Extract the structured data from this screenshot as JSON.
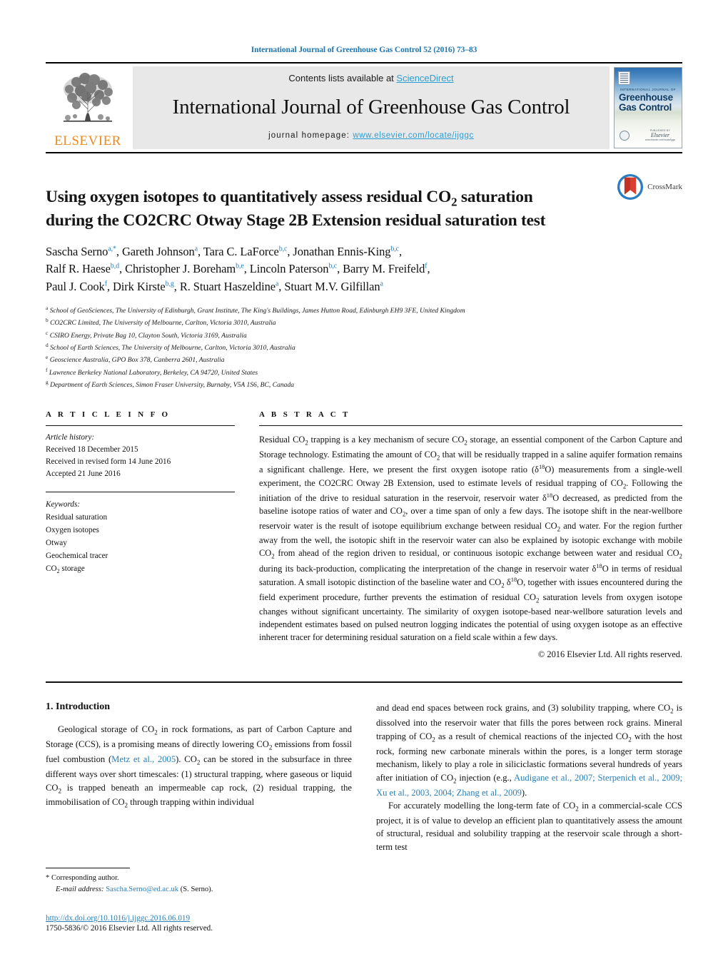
{
  "running_head": "International Journal of Greenhouse Gas Control 52 (2016) 73–83",
  "masthead": {
    "publisher_name": "ELSEVIER",
    "contents_prefix": "Contents lists available at ",
    "contents_link": "ScienceDirect",
    "journal_title": "International Journal of Greenhouse Gas Control",
    "homepage_prefix": "journal homepage: ",
    "homepage_url": "www.elsevier.com/locate/ijggc",
    "cover": {
      "kicker": "INTERNATIONAL JOURNAL OF",
      "line1": "Greenhouse",
      "line2": "Gas Control",
      "logo_top": "PUBLISHED BY",
      "logo_mid": "Elsevier",
      "logo_bottom": "www.elsevier.com/locate/ijggc"
    }
  },
  "article": {
    "title_line1": "Using oxygen isotopes to quantitatively assess residual CO",
    "title_sub1": "2",
    "title_line1b": " saturation",
    "title_line2": "during the CO2CRC Otway Stage 2B Extension residual saturation test",
    "crossmark_label": "CrossMark",
    "authors": [
      {
        "name": "Sascha Serno",
        "marks": "a,*"
      },
      {
        "name": "Gareth Johnson",
        "marks": "a"
      },
      {
        "name": "Tara C. LaForce",
        "marks": "b,c"
      },
      {
        "name": "Jonathan Ennis-King",
        "marks": "b,c"
      },
      {
        "name": "Ralf R. Haese",
        "marks": "b,d"
      },
      {
        "name": "Christopher J. Boreham",
        "marks": "b,e"
      },
      {
        "name": "Lincoln Paterson",
        "marks": "b,c"
      },
      {
        "name": "Barry M. Freifeld",
        "marks": "f"
      },
      {
        "name": "Paul J. Cook",
        "marks": "f"
      },
      {
        "name": "Dirk Kirste",
        "marks": "b,g"
      },
      {
        "name": "R. Stuart Haszeldine",
        "marks": "a"
      },
      {
        "name": "Stuart M.V. Gilfillan",
        "marks": "a"
      }
    ],
    "affiliations": [
      {
        "mark": "a",
        "text": "School of GeoSciences, The University of Edinburgh, Grant Institute, The King's Buildings, James Hutton Road, Edinburgh EH9 3FE, United Kingdom"
      },
      {
        "mark": "b",
        "text": "CO2CRC Limited, The University of Melbourne, Carlton, Victoria 3010, Australia"
      },
      {
        "mark": "c",
        "text": "CSIRO Energy, Private Bag 10, Clayton South, Victoria 3169, Australia"
      },
      {
        "mark": "d",
        "text": "School of Earth Sciences, The University of Melbourne, Carlton, Victoria 3010, Australia"
      },
      {
        "mark": "e",
        "text": "Geoscience Australia, GPO Box 378, Canberra 2601, Australia"
      },
      {
        "mark": "f",
        "text": "Lawrence Berkeley National Laboratory, Berkeley, CA 94720, United States"
      },
      {
        "mark": "g",
        "text": "Department of Earth Sciences, Simon Fraser University, Burnaby, V5A 1S6, BC, Canada"
      }
    ]
  },
  "article_info": {
    "heading": "A R T I C L E   I N F O",
    "history_label": "Article history:",
    "history": [
      "Received 18 December 2015",
      "Received in revised form 14 June 2016",
      "Accepted 21 June 2016"
    ],
    "keywords_label": "Keywords:",
    "keywords": [
      "Residual saturation",
      "Oxygen isotopes",
      "Otway",
      "Geochemical tracer",
      "CO2 storage"
    ]
  },
  "abstract": {
    "heading": "A B S T R A C T",
    "copyright": "© 2016 Elsevier Ltd. All rights reserved."
  },
  "introduction": {
    "heading": "1. Introduction",
    "left_refs": [
      "Metz et al., 2005"
    ],
    "right_refs": [
      "Audigane et al., 2007; Sterpenich et al., 2009; Xu et al., 2003, 2004; Zhang et al., 2009"
    ]
  },
  "footer": {
    "corresponding": "* Corresponding author.",
    "email_label": "E-mail address:",
    "email": "Sascha.Serno@ed.ac.uk",
    "email_suffix": "(S. Serno).",
    "doi": "http://dx.doi.org/10.1016/j.ijggc.2016.06.019",
    "issn": "1750-5836/© 2016 Elsevier Ltd. All rights reserved."
  },
  "colors": {
    "link_blue": "#2a7fb8",
    "header_blue": "#1f76b0",
    "sciencedirect_blue": "#2a9fd6",
    "elsevier_orange": "#ec8a1e",
    "banner_gray": "#e8e8e8",
    "crossmark_red": "#d8412f",
    "crossmark_blue": "#2b7cc0"
  }
}
